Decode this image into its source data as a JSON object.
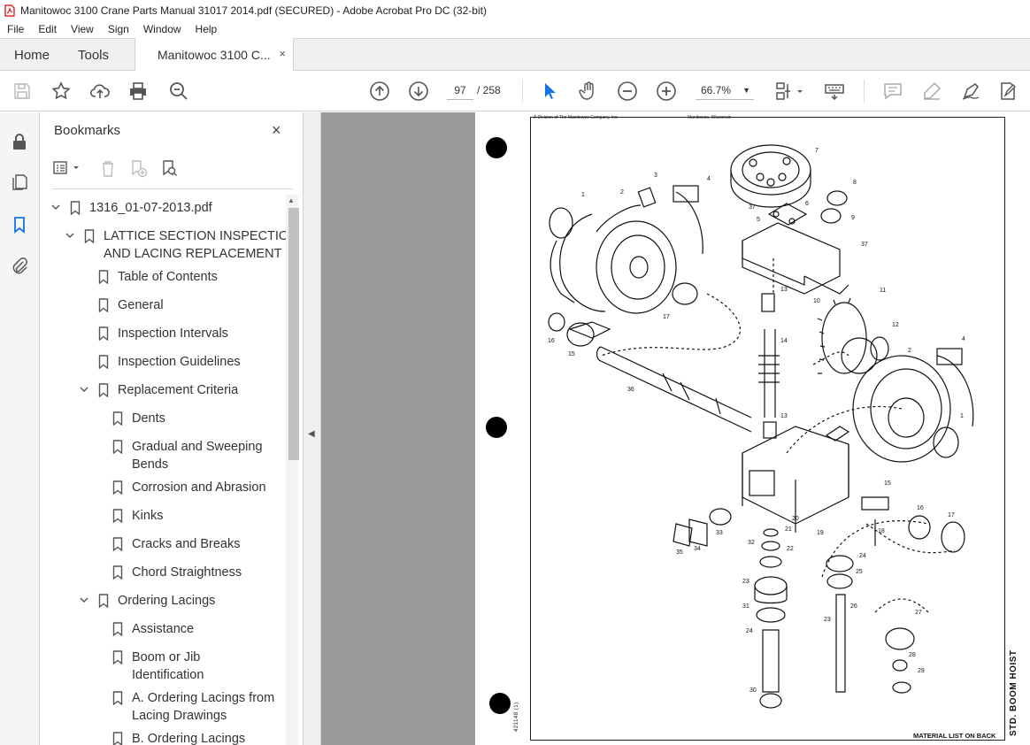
{
  "window": {
    "title": "Manitowoc 3100 Crane Parts Manual 31017 2014.pdf (SECURED) - Adobe Acrobat Pro DC (32-bit)"
  },
  "menu": [
    "File",
    "Edit",
    "View",
    "Sign",
    "Window",
    "Help"
  ],
  "tabs": {
    "home": "Home",
    "tools": "Tools",
    "doc": "Manitowoc 3100 C...",
    "close": "×"
  },
  "nav": {
    "page_current": "97",
    "page_total": "/ 258",
    "zoom": "66.7%"
  },
  "bookmarks": {
    "title": "Bookmarks",
    "close": "×",
    "items": [
      {
        "label": "1316_01-07-2013.pdf"
      },
      {
        "label": "LATTICE SECTION INSPECTION"
      },
      {
        "label": "AND LACING REPLACEMENT"
      },
      {
        "label": "Table of Contents"
      },
      {
        "label": "General"
      },
      {
        "label": "Inspection Intervals"
      },
      {
        "label": "Inspection Guidelines"
      },
      {
        "label": "Replacement Criteria"
      },
      {
        "label": "Dents"
      },
      {
        "label": "Gradual and Sweeping"
      },
      {
        "label": "Bends"
      },
      {
        "label": "Corrosion and Abrasion"
      },
      {
        "label": "Kinks"
      },
      {
        "label": "Cracks and Breaks"
      },
      {
        "label": "Chord Straightness"
      },
      {
        "label": "Ordering Lacings"
      },
      {
        "label": "Assistance"
      },
      {
        "label": "Boom or Jib"
      },
      {
        "label": "Identification"
      },
      {
        "label": "A. Ordering Lacings from"
      },
      {
        "label": "Lacing Drawings"
      },
      {
        "label": "B. Ordering Lacings"
      }
    ]
  },
  "page": {
    "header_left": "A Division of The Manitowoc Company, Inc.",
    "header_right": "Manitowoc, Wisconsin",
    "drawing_no": "421148 (1)",
    "side_label": "STD. BOOM HOIST",
    "footer": "MATERIAL LIST ON BACK",
    "callouts": [
      "1",
      "2",
      "3",
      "4",
      "7",
      "8",
      "9",
      "37",
      "5",
      "6",
      "37",
      "10",
      "13",
      "11",
      "12",
      "4",
      "2",
      "1",
      "17",
      "16",
      "15",
      "14",
      "36",
      "13",
      "15",
      "16",
      "17",
      "18",
      "19",
      "20",
      "21",
      "32",
      "22",
      "23",
      "31",
      "24",
      "33",
      "34",
      "35",
      "24",
      "25",
      "23",
      "26",
      "27",
      "28",
      "29",
      "30"
    ]
  },
  "colors": {
    "viewport_bg": "#9b9b9b",
    "accent": "#1473e6"
  }
}
